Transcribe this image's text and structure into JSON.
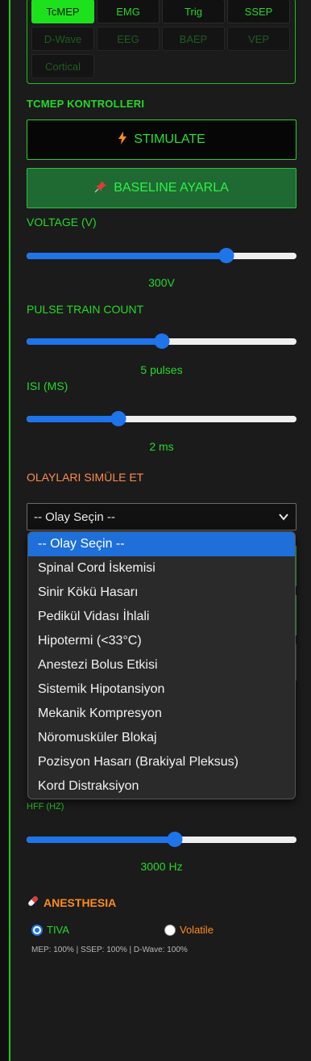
{
  "modalities": {
    "row1": [
      "TcMEP",
      "EMG",
      "Trig",
      "SSEP"
    ],
    "row2": [
      "D-Wave",
      "EEG",
      "BAEP",
      "VEP"
    ],
    "row3": [
      "Cortical"
    ],
    "active": "TcMEP"
  },
  "tcmep": {
    "section_title": "TCMEP KONTROLLERI",
    "stimulate_label": "STIMULATE",
    "stimulate_icon": "lightning-icon",
    "baseline_label": "BASELINE AYARLA",
    "baseline_icon": "pushpin-icon"
  },
  "sliders": {
    "voltage": {
      "label": "VOLTAGE (V)",
      "value_text": "300V",
      "fraction": 0.74
    },
    "pulse": {
      "label": "PULSE TRAIN COUNT",
      "value_text": "5 pulses",
      "fraction": 0.5
    },
    "isi": {
      "label": "ISI (MS)",
      "value_text": "2 ms",
      "fraction": 0.34
    },
    "hff": {
      "label": "HFF (HZ)",
      "value_text": "3000 Hz",
      "fraction": 0.55
    }
  },
  "events": {
    "label": "OLAYLARI SIMÜLE ET",
    "selected": "-- Olay Seçin --",
    "options": [
      "-- Olay Seçin --",
      "Spinal Cord İskemisi",
      "Sinir Kökü Hasarı",
      "Pedikül Vidası İhlali",
      "Hipotermi (<33°C)",
      "Anestezi Bolus Etkisi",
      "Sistemik Hipotansiyon",
      "Mekanik Kompresyon",
      "Nöromusküler Blokaj",
      "Pozisyon Hasarı (Brakiyal Pleksus)",
      "Kord Distraksiyon"
    ]
  },
  "anesthesia": {
    "title": "ANESTHESIA",
    "icon": "pill-icon",
    "tiva_label": "TIVA",
    "volatile_label": "Volatile",
    "selected": "TIVA",
    "status": "MEP: 100% | SSEP: 100% | D-Wave: 100%"
  },
  "colors": {
    "accent_green": "#25d92a",
    "slider_blue": "#1f74ea",
    "orange": "#ff8a4f"
  }
}
